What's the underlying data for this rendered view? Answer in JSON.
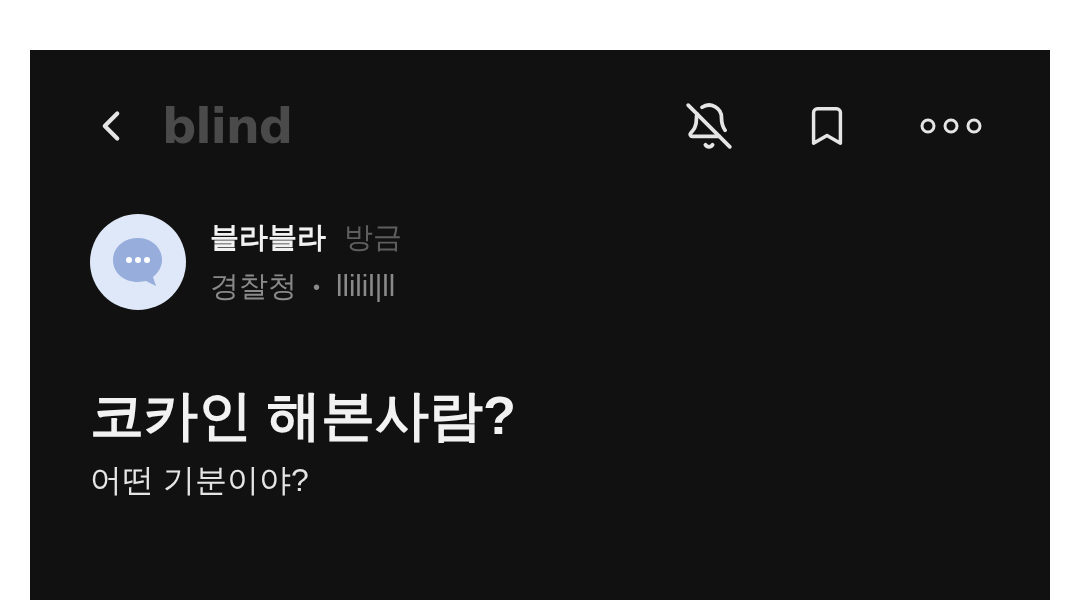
{
  "header": {
    "logo": "blind",
    "notifications_muted": true
  },
  "author": {
    "name": "블라블라",
    "time": "방금",
    "company": "경찰청",
    "separator": "•",
    "nickname": "llilil|ll"
  },
  "post": {
    "title": "코카인 해본사람?",
    "body": "어떤 기분이야?"
  }
}
